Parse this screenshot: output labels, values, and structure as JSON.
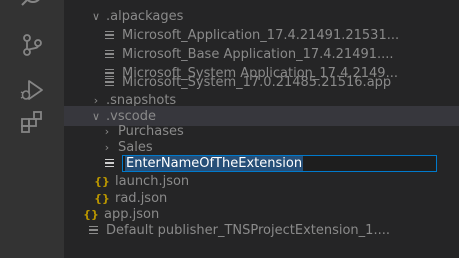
{
  "activity_bar": {
    "icons": [
      "search-icon",
      "source-control-icon",
      "run-debug-icon",
      "extensions-icon"
    ]
  },
  "explorer": {
    "alpackages": {
      "label": ".alpackages",
      "files": [
        "Microsoft_Application_17.4.21491.21531...",
        "Microsoft_Base Application_17.4.21491....",
        "Microsoft_System Application_17.4.2149...",
        "Microsoft_System_17.0.21485.21516.app"
      ]
    },
    "snapshots": {
      "label": ".snapshots"
    },
    "vscode": {
      "label": ".vscode",
      "purchases": "Purchases",
      "sales": "Sales",
      "rename_value": "EnterNameOfTheExtension",
      "launch": "launch.json",
      "rad": "rad.json"
    },
    "app_json": "app.json",
    "default_publisher": "Default publisher_TNSProjectExtension_1...."
  }
}
